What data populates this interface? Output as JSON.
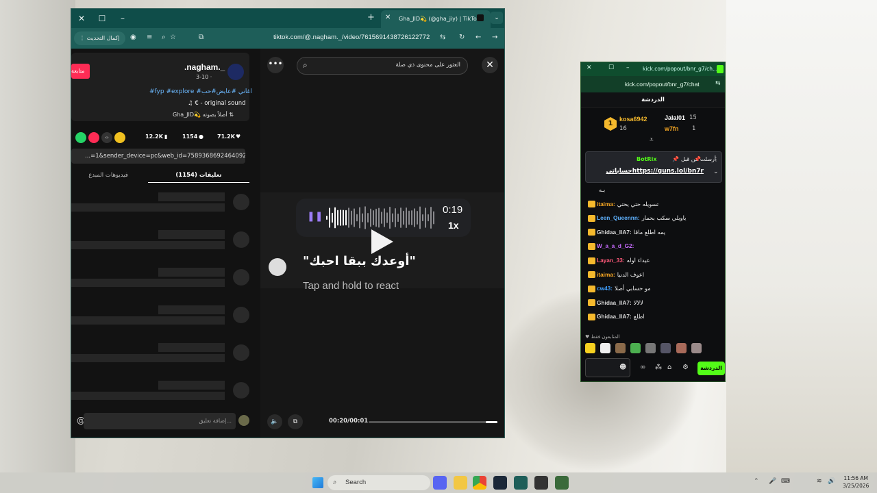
{
  "tiktok": {
    "tab_title": "Gha_JID💫 (@gha_jiy) | TikTok",
    "url": "tiktok.com/@.nagham._/video/7615691438726122772",
    "update_button": "إكمال التحديث",
    "post": {
      "username": ".nagham._",
      "date": "3-10 · ",
      "follow_label": "متابعة",
      "tags": "#fyp #explore #اغاني #عايض#حب",
      "sound": "€ - original sound",
      "duet": "Gha_JID💫 أصلاً بصوته",
      "likes": "71.2K",
      "comments": "1154",
      "saves": "12.2K",
      "link": "...=1&sender_device=pc&web_id=7589368692464092688",
      "tabs": [
        "تعليقات (1154)",
        "فيديوهات المبدع"
      ]
    },
    "comment_placeholder": "إضافة تعليق...",
    "search_placeholder": "العثور على محتوى ذي صلة",
    "voice": {
      "time": "0:19",
      "speed": "1x",
      "progress": 0.82
    },
    "quote": "\"أوعدك ببقا احبك\"",
    "react_hint": "Tap and hold to react",
    "player_time": "00:20/00:01",
    "player_progress": 0.09
  },
  "kick": {
    "title": "kick.com/popout/bnr_g7/ch...",
    "url": "kick.com/popout/bnr_g7/chat",
    "header": "الدردشة",
    "top_gifters": [
      {
        "name": "kosa6942",
        "count": "16",
        "rank": "1"
      },
      {
        "name": "Jalal01",
        "count": "15"
      },
      {
        "name": "w7fn",
        "count": "1"
      }
    ],
    "pinned": {
      "header": "أرسلت من قبل",
      "bot": "BotRix",
      "text": "حساباتيhttps://guns.lol/bn7r"
    },
    "messages": [
      {
        "user": "",
        "text": "بـه",
        "color": "#ffffff"
      },
      {
        "user": "itaima:",
        "text": "تسويله حتي يحتي",
        "color": "#f5a623"
      },
      {
        "user": "Leen_Queennn:",
        "text": "ياويلي سكب بحمار",
        "color": "#5fb2ff"
      },
      {
        "user": "Ghidaa_llA7:",
        "text": "يمه اطلع ماقا",
        "color": "#d8d8d8"
      },
      {
        "user": "W_a_a_d_G2:",
        "text": "",
        "color": "#c76bff"
      },
      {
        "user": "Layan_33:",
        "text": "عيداء اوله",
        "color": "#ff5a7a"
      },
      {
        "user": "itaima:",
        "text": "اعوف الدنيا",
        "color": "#f5a623"
      },
      {
        "user": "cw43:",
        "text": "مو حسابي أصلا",
        "color": "#3fa0ff"
      },
      {
        "user": "Ghidaa_llA7:",
        "text": "لالالا",
        "color": "#d8d8d8"
      },
      {
        "user": "Ghidaa_llA7:",
        "text": "اطلع",
        "color": "#d8d8d8"
      }
    ],
    "followers_label": "المتابعون فقط",
    "send_label": "الدردشة"
  },
  "taskbar": {
    "search": "Search",
    "clock_time": "11:56 AM",
    "clock_date": "3/25/2026"
  }
}
